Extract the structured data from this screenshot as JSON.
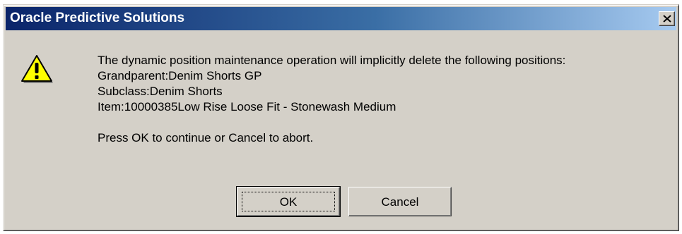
{
  "window": {
    "title": "Oracle Predictive Solutions",
    "close_icon": "close-icon",
    "warning_icon": "warning-icon"
  },
  "message": {
    "lines": [
      "The dynamic position maintenance operation will implicitly delete the following positions:",
      "Grandparent:Denim Shorts GP",
      "Subclass:Denim Shorts",
      "Item:10000385Low Rise Loose Fit - Stonewash Medium"
    ],
    "prompt": "Press OK to continue or Cancel to abort."
  },
  "buttons": {
    "ok_label": "OK",
    "cancel_label": "Cancel"
  },
  "colors": {
    "title_gradient_start": "#0a246a",
    "title_gradient_end": "#a6caf0",
    "dialog_face": "#d4d0c8",
    "warning_yellow": "#ffff00"
  }
}
